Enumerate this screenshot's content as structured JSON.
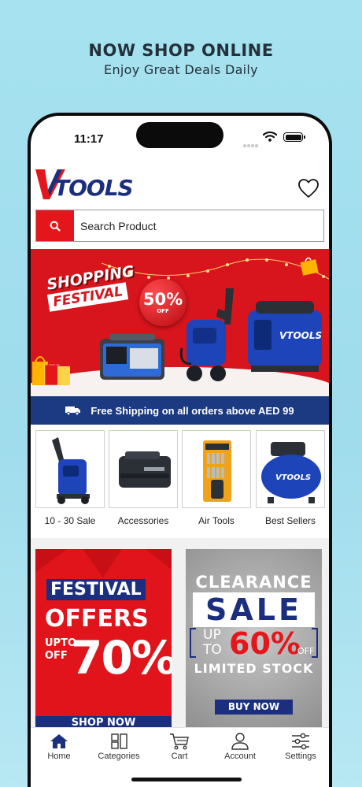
{
  "marketing": {
    "headline": "NOW SHOP ONLINE",
    "subline": "Enjoy Great Deals Daily"
  },
  "status_bar": {
    "time": "11:17",
    "icons": [
      "signal-icon",
      "wifi-icon",
      "battery-icon"
    ]
  },
  "header": {
    "logo_text": "TOOLS",
    "logo_initial": "V",
    "wishlist_icon": "heart-icon"
  },
  "search": {
    "placeholder": "Search Product",
    "icon": "search-icon"
  },
  "hero_banner": {
    "line1": "SHOPPING",
    "line2": "FESTIVAL",
    "discount": "50%",
    "discount_suffix": "OFF",
    "product_brand": "VTOOLS"
  },
  "shipping_bar": {
    "icon": "truck-icon",
    "text": "Free Shipping on all orders above AED 99"
  },
  "categories": [
    {
      "label": "10 - 30 Sale",
      "icon": "pressure-washer-image"
    },
    {
      "label": "Accessories",
      "icon": "battery-pack-image"
    },
    {
      "label": "Air Tools",
      "icon": "bit-set-image"
    },
    {
      "label": "Best Sellers",
      "icon": "air-compressor-image"
    }
  ],
  "promos": {
    "festival": {
      "title": "FESTIVAL",
      "subtitle": "OFFERS",
      "upto": "UPTO",
      "off": "OFF",
      "percent": "70%",
      "cta": "SHOP NOW"
    },
    "clearance": {
      "title": "CLEARANCE",
      "sale": "SALE",
      "up": "UP",
      "to": "TO",
      "percent": "60%",
      "off": "OFF",
      "limited": "LIMITED STOCK",
      "cta": "BUY NOW"
    }
  },
  "tabbar": {
    "items": [
      {
        "label": "Home",
        "icon": "home-icon",
        "active": true
      },
      {
        "label": "Categories",
        "icon": "categories-icon"
      },
      {
        "label": "Cart",
        "icon": "cart-icon"
      },
      {
        "label": "Account",
        "icon": "account-icon"
      },
      {
        "label": "Settings",
        "icon": "settings-icon"
      }
    ]
  },
  "colors": {
    "brand_red": "#e4161c",
    "brand_navy": "#1b2f7e",
    "shipping_bar": "#1b3a82",
    "background_cyan": "#a6e2ef"
  }
}
